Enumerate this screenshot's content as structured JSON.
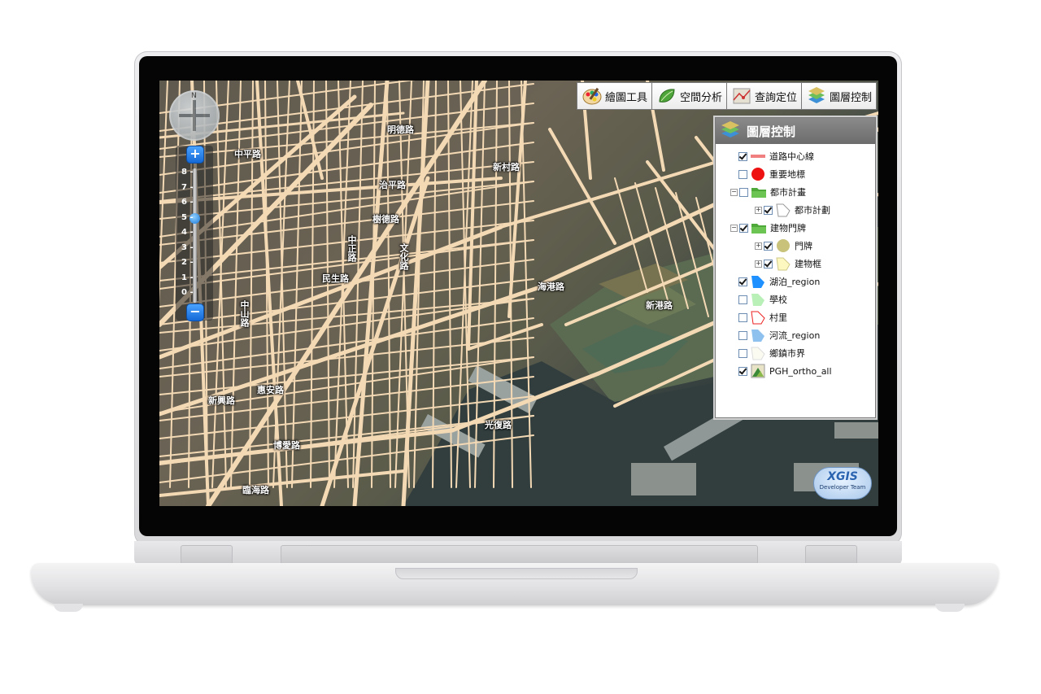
{
  "toolbar": {
    "draw_tools": "繪圖工具",
    "spatial_analysis": "空間分析",
    "query_locate": "查詢定位",
    "layer_control": "圖層控制"
  },
  "navigation": {
    "compass_label": "N",
    "zoom_in": "+",
    "zoom_out": "−",
    "zoom_levels": [
      "8",
      "7",
      "6",
      "5",
      "4",
      "3",
      "2",
      "1",
      "0"
    ],
    "current_level": 5
  },
  "layer_panel": {
    "title": "圖層控制",
    "layers": [
      {
        "label": "道路中心線",
        "checked": true,
        "symbol": "line-red"
      },
      {
        "label": "重要地標",
        "checked": false,
        "symbol": "dot-red"
      },
      {
        "label": "都市計畫",
        "checked": false,
        "symbol": "folder-green",
        "group": true
      },
      {
        "label": "都市計劃",
        "checked": true,
        "symbol": "polygon-outline",
        "child": true
      },
      {
        "label": "建物門牌",
        "checked": true,
        "symbol": "folder-green",
        "group": true
      },
      {
        "label": "門牌",
        "checked": true,
        "symbol": "dot-olive",
        "child": true
      },
      {
        "label": "建物框",
        "checked": true,
        "symbol": "polygon-yellow",
        "child": true
      },
      {
        "label": "湖泊_region",
        "checked": true,
        "symbol": "polygon-blue"
      },
      {
        "label": "學校",
        "checked": false,
        "symbol": "polygon-lightgreen"
      },
      {
        "label": "村里",
        "checked": false,
        "symbol": "polygon-redoutline"
      },
      {
        "label": "河流_region",
        "checked": false,
        "symbol": "polygon-lightblue"
      },
      {
        "label": "鄉鎮市界",
        "checked": false,
        "symbol": "polygon-white"
      },
      {
        "label": "PGH_ortho_all",
        "checked": true,
        "symbol": "raster"
      }
    ]
  },
  "map_labels": {
    "l1": "明德路",
    "l2": "中平路",
    "l3": "治平路",
    "l4": "樹德路",
    "l5": "中正路",
    "l6": "文化路",
    "l7": "民生路",
    "l8": "新興路",
    "l9": "新村路",
    "l10": "惠安路",
    "l11": "臨海路",
    "l12": "海港路",
    "l13": "新港路",
    "l14": "中山路",
    "l15": "博愛路",
    "l16": "光復路"
  },
  "logo": {
    "main": "XGIS",
    "sub": "Developer Team"
  },
  "colors": {
    "road": "#f4d9b5",
    "panel_header": "#7a7a7a",
    "water": "#33403f"
  }
}
